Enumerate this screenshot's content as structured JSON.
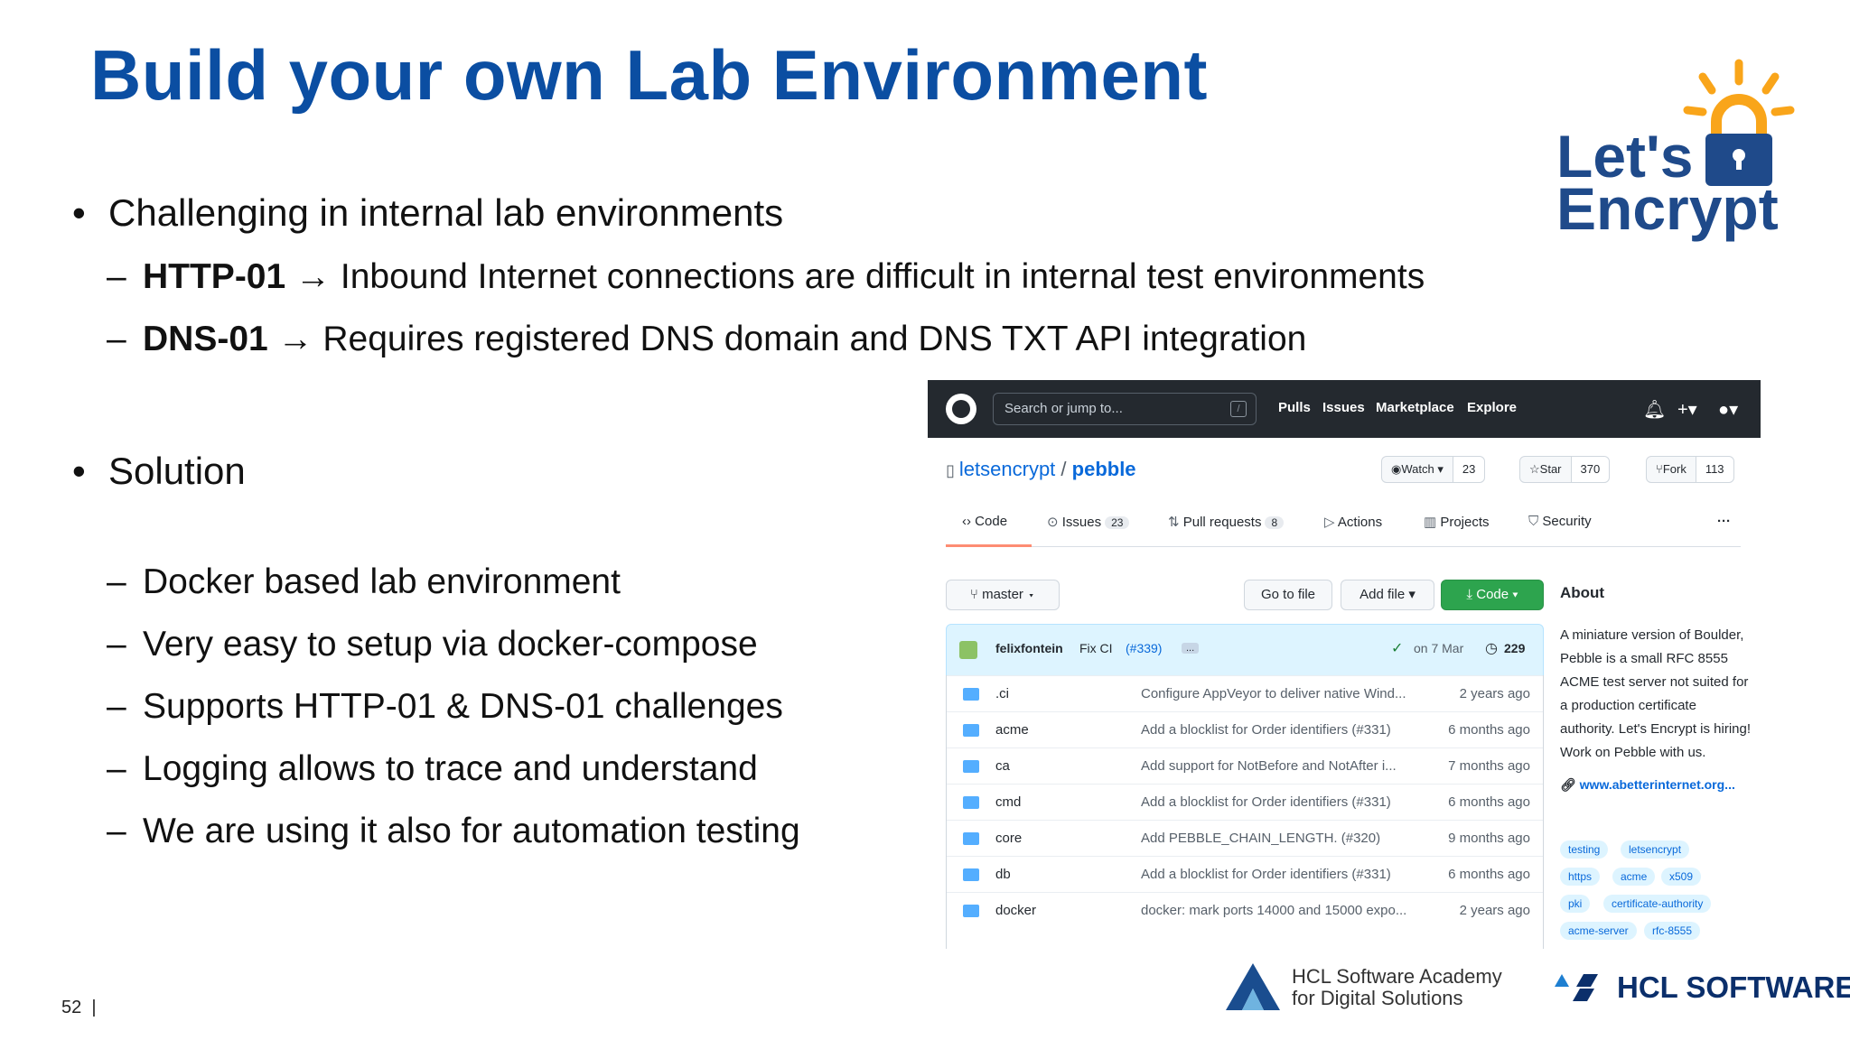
{
  "slide": {
    "title": "Build your own Lab Environment",
    "bullet1": "Challenging in internal lab environments",
    "sub1_bold": "HTTP-01",
    "sub1_text": " → Inbound Internet connections are difficult in internal test environments",
    "sub2_bold": "DNS-01",
    "sub2_text": " → Requires registered DNS domain and DNS TXT API integration",
    "bullet2": "Solution",
    "solutions": [
      "Docker based lab environment",
      "Very easy to setup via docker-compose",
      "Supports HTTP-01 & DNS-01 challenges",
      "Logging allows to trace and understand",
      "We are using it also for automation testing"
    ],
    "bullet_symbol": "•",
    "dash_symbol": "–",
    "page_number": "52",
    "page_sep": "|"
  },
  "logos": {
    "lets": "Let's",
    "encrypt": "Encrypt",
    "academy_line1": "HCL Software Academy",
    "academy_line2": "for Digital Solutions",
    "hcl_software": "HCL SOFTWARE"
  },
  "github": {
    "search_placeholder": "Search or jump to...",
    "slash": "/",
    "nav": [
      "Pulls",
      "Issues",
      "Marketplace",
      "Explore"
    ],
    "owner": "letsencrypt",
    "separator": " / ",
    "repo": "pebble",
    "watch_label": "Watch",
    "watch_count": "23",
    "star_label": "Star",
    "star_count": "370",
    "fork_label": "Fork",
    "fork_count": "113",
    "tabs": {
      "code": "Code",
      "issues": "Issues",
      "issues_count": "23",
      "pulls": "Pull requests",
      "pulls_count": "8",
      "actions": "Actions",
      "projects": "Projects",
      "security": "Security",
      "more": "···"
    },
    "branch": "master",
    "goto_file": "Go to file",
    "add_file": "Add file",
    "code_btn": "Code",
    "commit_author": "felixfontein",
    "commit_msg": "Fix CI",
    "commit_ref": "(#339)",
    "commit_more": "...",
    "commit_date": "on 7 Mar",
    "commit_count": "229",
    "files": [
      {
        "name": ".ci",
        "msg": "Configure AppVeyor to deliver native Wind...",
        "ago": "2 years ago"
      },
      {
        "name": "acme",
        "msg": "Add a blocklist for Order identifiers (#331)",
        "ago": "6 months ago"
      },
      {
        "name": "ca",
        "msg": "Add support for NotBefore and NotAfter i...",
        "ago": "7 months ago"
      },
      {
        "name": "cmd",
        "msg": "Add a blocklist for Order identifiers (#331)",
        "ago": "6 months ago"
      },
      {
        "name": "core",
        "msg": "Add PEBBLE_CHAIN_LENGTH. (#320)",
        "ago": "9 months ago"
      },
      {
        "name": "db",
        "msg": "Add a blocklist for Order identifiers (#331)",
        "ago": "6 months ago"
      },
      {
        "name": "docker",
        "msg": "docker: mark ports 14000 and 15000 expo...",
        "ago": "2 years ago"
      }
    ],
    "about_title": "About",
    "about_text": "A miniature version of Boulder, Pebble is a small RFC 8555 ACME test server not suited for a production certificate authority. Let's Encrypt is hiring! Work on Pebble with us.",
    "about_link": "www.abetterinternet.org...",
    "topics": [
      "testing",
      "letsencrypt",
      "https",
      "acme",
      "x509",
      "pki",
      "certificate-authority",
      "acme-server",
      "rfc-8555"
    ]
  },
  "colors": {
    "title_blue": "#0b4ea2",
    "github_dark": "#24292f",
    "link_blue": "#0969da",
    "green_button": "#2da44e",
    "lets_encrypt_orange": "#f9a51a"
  }
}
